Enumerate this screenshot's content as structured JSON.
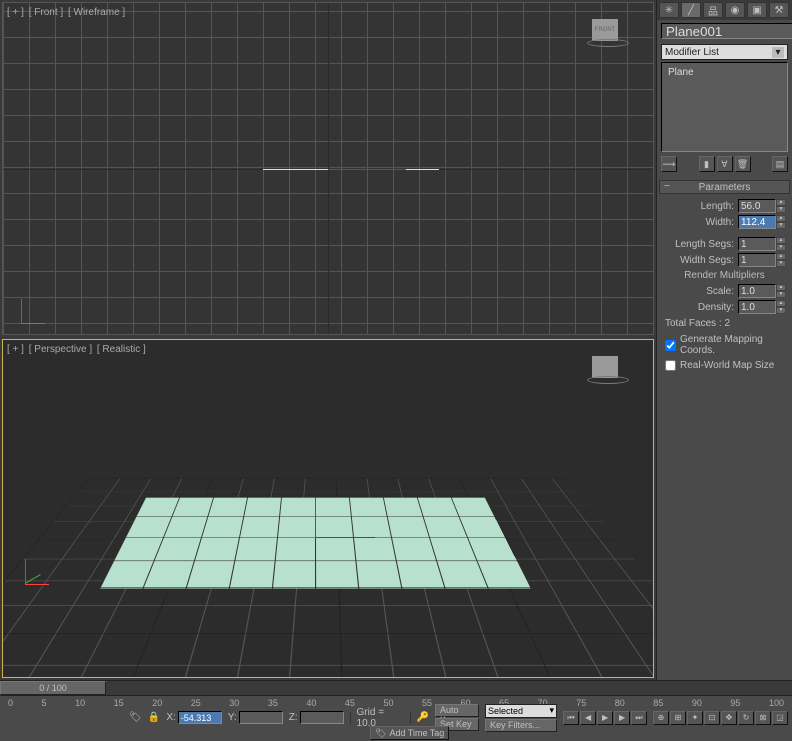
{
  "viewport_top": {
    "plus": "[ + ]",
    "name": "[ Front ]",
    "mode": "[ Wireframe ]",
    "cube": "FRONT"
  },
  "viewport_bottom": {
    "plus": "[ + ]",
    "name": "[ Perspective ]",
    "mode": "[ Realistic ]",
    "cube": "-"
  },
  "sidebar": {
    "object_name": "Plane001",
    "modifier_list_label": "Modifier List",
    "stack_item": "Plane"
  },
  "parameters": {
    "title": "Parameters",
    "length_label": "Length:",
    "length_value": "56.0",
    "width_label": "Width:",
    "width_value": "112.4",
    "length_segs_label": "Length Segs:",
    "length_segs_value": "1",
    "width_segs_label": "Width Segs:",
    "width_segs_value": "1",
    "render_mult": "Render Multipliers",
    "scale_label": "Scale:",
    "scale_value": "1.0",
    "density_label": "Density:",
    "density_value": "1.0",
    "total_faces": "Total Faces : 2",
    "gen_mapping": "Generate Mapping Coords.",
    "real_world": "Real-World Map Size"
  },
  "timeline": {
    "slider": "0 / 100",
    "ticks": [
      "0",
      "5",
      "10",
      "15",
      "20",
      "25",
      "30",
      "35",
      "40",
      "45",
      "50",
      "55",
      "60",
      "65",
      "70",
      "75",
      "80",
      "85",
      "90",
      "95",
      "100"
    ]
  },
  "status": {
    "x_label": "X:",
    "x_value": "-54.313",
    "y_label": "Y:",
    "y_value": "",
    "z_label": "Z:",
    "z_value": "",
    "grid": "Grid = 10.0",
    "auto_key": "Auto Key",
    "set_key": "Set Key",
    "selected": "Selected",
    "add_time_tag": "Add Time Tag",
    "key_filters": "Key Filters..."
  }
}
